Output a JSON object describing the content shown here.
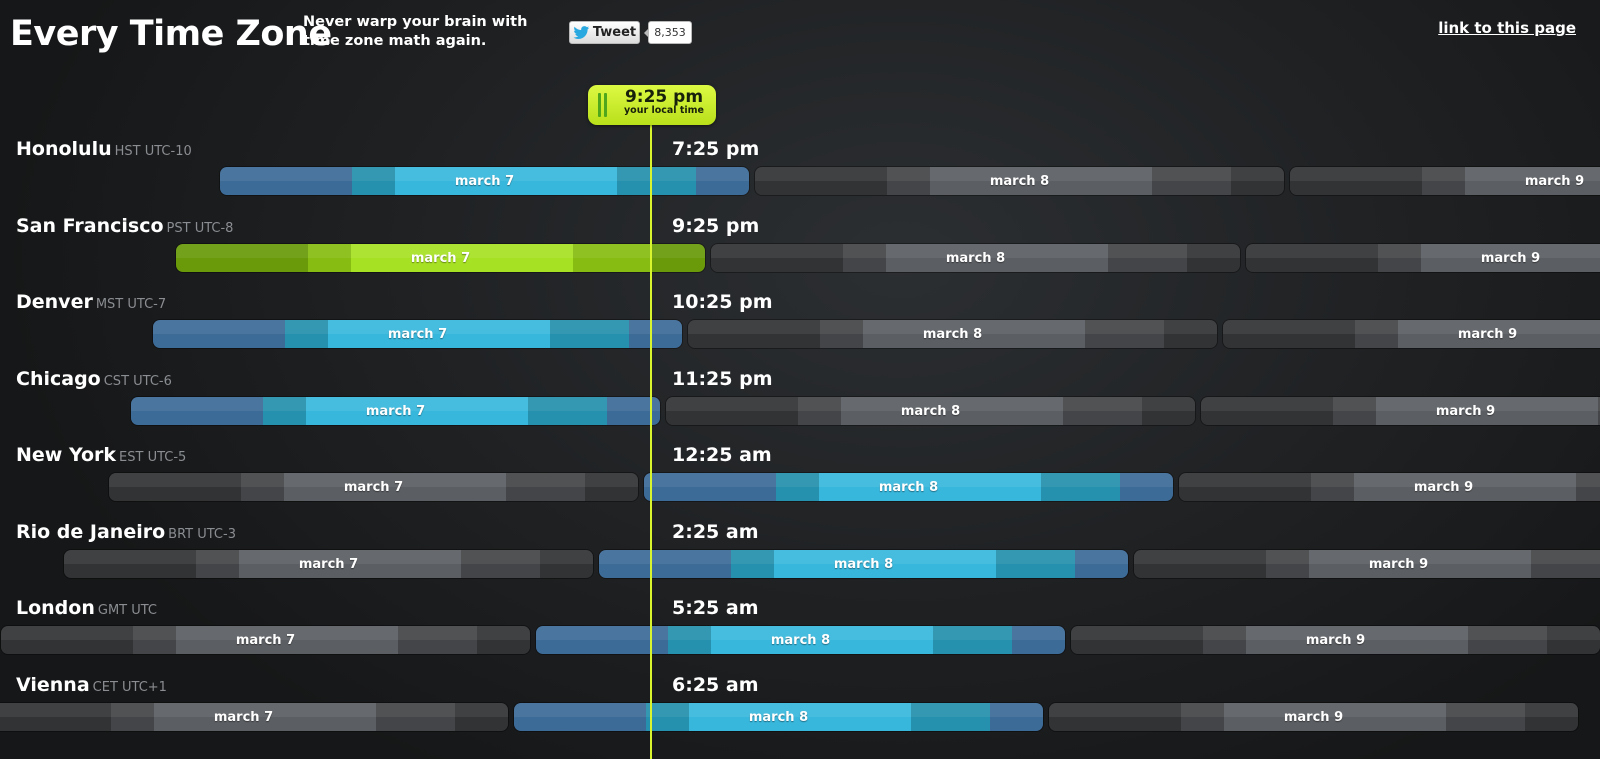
{
  "header": {
    "app_title": "Every Time Zone",
    "tagline": "Never warp your brain with time zone math again.",
    "tweet_label": "Tweet",
    "tweet_count": "8,353",
    "permalink_label": "link to this page"
  },
  "now": {
    "time": "9:25 pm",
    "caption": "your local time"
  },
  "colors": {
    "now_line": "#d8f52d",
    "current_day_blue": "#38b7dc",
    "local_day_green": "#a7e123",
    "other_day_gray": "#5b5e62"
  },
  "timezones": [
    {
      "city": "Honolulu",
      "abbr": "HST UTC-10",
      "time": "7:25 pm",
      "days": [
        {
          "label": "march 7",
          "style": "blue"
        },
        {
          "label": "march 8",
          "style": "gray"
        },
        {
          "label": "march 9",
          "style": "gray"
        }
      ]
    },
    {
      "city": "San Francisco",
      "abbr": "PST UTC-8",
      "time": "9:25 pm",
      "days": [
        {
          "label": "march 7",
          "style": "green"
        },
        {
          "label": "march 8",
          "style": "gray"
        },
        {
          "label": "march 9",
          "style": "gray"
        }
      ]
    },
    {
      "city": "Denver",
      "abbr": "MST UTC-7",
      "time": "10:25 pm",
      "days": [
        {
          "label": "march 7",
          "style": "blue"
        },
        {
          "label": "march 8",
          "style": "gray"
        },
        {
          "label": "march 9",
          "style": "gray"
        }
      ]
    },
    {
      "city": "Chicago",
      "abbr": "CST UTC-6",
      "time": "11:25 pm",
      "days": [
        {
          "label": "march 7",
          "style": "blue"
        },
        {
          "label": "march 8",
          "style": "gray"
        },
        {
          "label": "march 9",
          "style": "gray"
        }
      ]
    },
    {
      "city": "New York",
      "abbr": "EST UTC-5",
      "time": "12:25 am",
      "days": [
        {
          "label": "march 7",
          "style": "gray"
        },
        {
          "label": "march 8",
          "style": "blue"
        },
        {
          "label": "march 9",
          "style": "gray"
        }
      ]
    },
    {
      "city": "Rio de Janeiro",
      "abbr": "BRT UTC-3",
      "time": "2:25 am",
      "days": [
        {
          "label": "march 7",
          "style": "gray"
        },
        {
          "label": "march 8",
          "style": "blue"
        },
        {
          "label": "march 9",
          "style": "gray"
        }
      ]
    },
    {
      "city": "London",
      "abbr": "GMT UTC",
      "time": "5:25 am",
      "days": [
        {
          "label": "march 7",
          "style": "gray"
        },
        {
          "label": "march 8",
          "style": "blue"
        },
        {
          "label": "march 9",
          "style": "gray"
        }
      ]
    },
    {
      "city": "Vienna",
      "abbr": "CET UTC+1",
      "time": "6:25 am",
      "days": [
        {
          "label": "march 7",
          "style": "gray"
        },
        {
          "label": "march 8",
          "style": "blue"
        },
        {
          "label": "march 9",
          "style": "gray"
        }
      ]
    }
  ]
}
